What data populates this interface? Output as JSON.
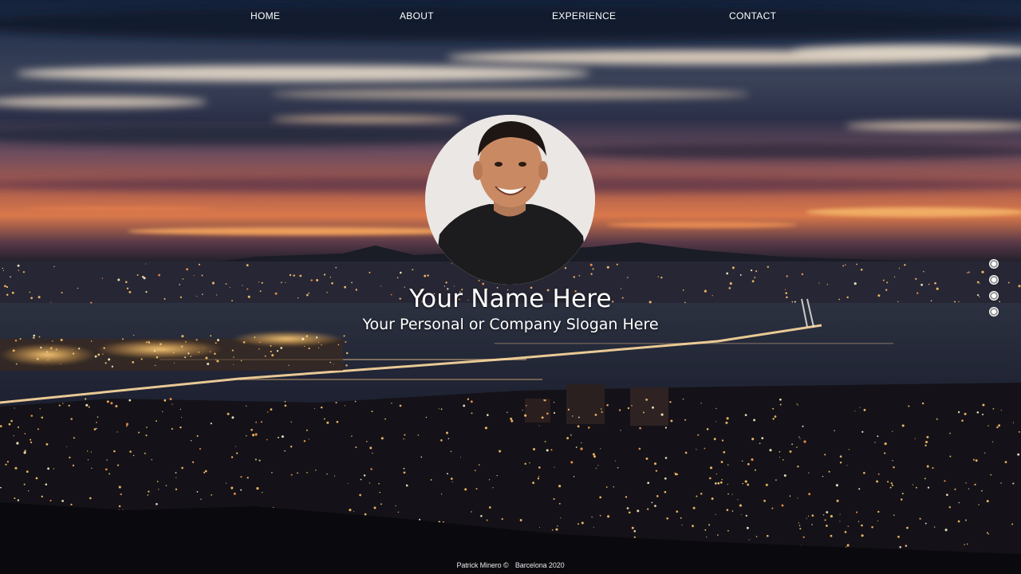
{
  "nav": {
    "items": [
      {
        "label": "HOME"
      },
      {
        "label": "ABOUT"
      },
      {
        "label": "EXPERIENCE"
      },
      {
        "label": "CONTACT"
      }
    ]
  },
  "hero": {
    "name": "Your Name Here",
    "slogan": "Your Personal or Company Slogan Here"
  },
  "footer": {
    "author": "Patrick Minero ©",
    "location_year": "Barcelona 2020"
  },
  "section_dots": {
    "count": 4
  },
  "colors": {
    "text": "#ffffff",
    "sky_dark": "#1b2a42",
    "sunset_orange": "#e8804a",
    "city_light": "#ffb347"
  }
}
